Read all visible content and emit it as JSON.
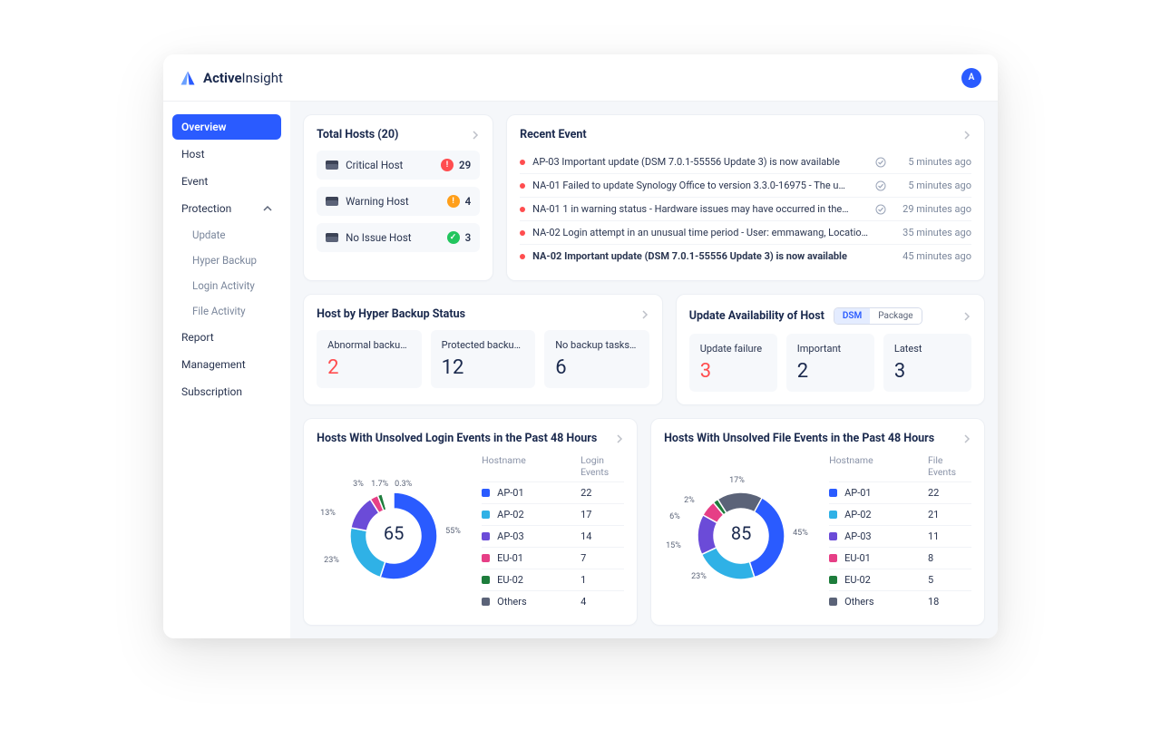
{
  "brand": {
    "strong": "Active",
    "light": "Insight"
  },
  "avatar": "A",
  "sidebar": {
    "items": [
      {
        "label": "Overview",
        "active": true
      },
      {
        "label": "Host"
      },
      {
        "label": "Event"
      },
      {
        "label": "Protection",
        "expandable": true,
        "expanded": true,
        "children": [
          {
            "label": "Update"
          },
          {
            "label": "Hyper Backup"
          },
          {
            "label": "Login Activity"
          },
          {
            "label": "File Activity"
          }
        ]
      },
      {
        "label": "Report"
      },
      {
        "label": "Management"
      },
      {
        "label": "Subscription"
      }
    ]
  },
  "totalHosts": {
    "title": "Total Hosts (20)",
    "rows": [
      {
        "label": "Critical Host",
        "dot": "red",
        "dotGlyph": "!",
        "count": "29"
      },
      {
        "label": "Warning Host",
        "dot": "orange",
        "dotGlyph": "!",
        "count": "4"
      },
      {
        "label": "No Issue Host",
        "dot": "green",
        "dotGlyph": "✓",
        "count": "3"
      }
    ]
  },
  "recent": {
    "title": "Recent Event",
    "events": [
      {
        "text": "AP-03 Important update (DSM 7.0.1-55556 Update 3) is now available",
        "check": true,
        "time": "5 minutes ago",
        "bold": false
      },
      {
        "text": "NA-01 Failed to update Synology Office to version 3.3.0-16975 - The u…",
        "check": true,
        "time": "5 minutes ago",
        "bold": false
      },
      {
        "text": "NA-01 1 in warning status - Hardware issues may have occurred in the…",
        "check": true,
        "time": "29 minutes ago",
        "bold": false
      },
      {
        "text": "NA-02 Login attempt in an unusual time period - User: emmawang, Locatio…",
        "check": false,
        "time": "35 minutes ago",
        "bold": false
      },
      {
        "text": "NA-02 Important update (DSM 7.0.1-55556 Update 3) is now available",
        "check": false,
        "time": "45 minutes ago",
        "bold": true
      }
    ]
  },
  "hyperBackup": {
    "title": "Host by Hyper Backup Status",
    "stats": [
      {
        "label": "Abnormal backups",
        "value": "2",
        "red": true
      },
      {
        "label": "Protected backup…",
        "value": "12"
      },
      {
        "label": "No backup tasks…",
        "value": "6"
      }
    ]
  },
  "updateAvail": {
    "title": "Update Availability of Host",
    "seg": [
      {
        "label": "DSM",
        "active": true
      },
      {
        "label": "Package"
      }
    ],
    "stats": [
      {
        "label": "Update failure",
        "value": "3",
        "red": true
      },
      {
        "label": "Important",
        "value": "2"
      },
      {
        "label": "Latest",
        "value": "3"
      }
    ]
  },
  "loginChart": {
    "title": "Hosts With Unsolved Login Events in the Past 48 Hours",
    "center": "65",
    "headers": [
      "Hostname",
      "Login Events"
    ],
    "legend": [
      {
        "color": "#2a5bff",
        "name": "AP-01",
        "num": "22"
      },
      {
        "color": "#2fb1e6",
        "name": "AP-02",
        "num": "17"
      },
      {
        "color": "#6b4bd8",
        "name": "AP-03",
        "num": "14"
      },
      {
        "color": "#e63f86",
        "name": "EU-01",
        "num": "7"
      },
      {
        "color": "#1e7d3c",
        "name": "EU-02",
        "num": "1"
      },
      {
        "color": "#5b6378",
        "name": "Others",
        "num": "4"
      }
    ],
    "labels": [
      {
        "text": "55%",
        "top": 68,
        "left": 142
      },
      {
        "text": "23%",
        "top": 100,
        "left": 8
      },
      {
        "text": "13%",
        "top": 48,
        "left": 4
      },
      {
        "text": "3%",
        "top": 16,
        "left": 40
      },
      {
        "text": "1.7%",
        "top": 16,
        "left": 60
      },
      {
        "text": "0.3%",
        "top": 16,
        "left": 86
      }
    ]
  },
  "fileChart": {
    "title": "Hosts With Unsolved File Events in the Past 48 Hours",
    "center": "85",
    "headers": [
      "Hostname",
      "File Events"
    ],
    "legend": [
      {
        "color": "#2a5bff",
        "name": "AP-01",
        "num": "22"
      },
      {
        "color": "#2fb1e6",
        "name": "AP-02",
        "num": "21"
      },
      {
        "color": "#6b4bd8",
        "name": "AP-03",
        "num": "11"
      },
      {
        "color": "#e63f86",
        "name": "EU-01",
        "num": "8"
      },
      {
        "color": "#1e7d3c",
        "name": "EU-02",
        "num": "5"
      },
      {
        "color": "#5b6378",
        "name": "Others",
        "num": "18"
      }
    ],
    "labels": [
      {
        "text": "45%",
        "top": 70,
        "left": 142
      },
      {
        "text": "23%",
        "top": 118,
        "left": 30
      },
      {
        "text": "15%",
        "top": 84,
        "left": 2
      },
      {
        "text": "6%",
        "top": 52,
        "left": 6
      },
      {
        "text": "2%",
        "top": 34,
        "left": 22
      },
      {
        "text": "17%",
        "top": 12,
        "left": 72
      }
    ]
  },
  "chart_data": [
    {
      "type": "pie",
      "title": "Hosts With Unsolved Login Events in the Past 48 Hours",
      "total": 65,
      "series": [
        {
          "name": "AP-01",
          "value": 22,
          "pct": 55,
          "color": "#2a5bff"
        },
        {
          "name": "AP-02",
          "value": 17,
          "pct": 23,
          "color": "#2fb1e6"
        },
        {
          "name": "AP-03",
          "value": 14,
          "pct": 13,
          "color": "#6b4bd8"
        },
        {
          "name": "EU-01",
          "value": 7,
          "pct": 3,
          "color": "#e63f86"
        },
        {
          "name": "EU-02",
          "value": 1,
          "pct": 1.7,
          "color": "#1e7d3c"
        },
        {
          "name": "Others",
          "value": 4,
          "pct": 0.3,
          "color": "#5b6378"
        }
      ]
    },
    {
      "type": "pie",
      "title": "Hosts With Unsolved File Events in the Past 48 Hours",
      "total": 85,
      "series": [
        {
          "name": "AP-01",
          "value": 22,
          "pct": 45,
          "color": "#2a5bff"
        },
        {
          "name": "AP-02",
          "value": 21,
          "pct": 23,
          "color": "#2fb1e6"
        },
        {
          "name": "AP-03",
          "value": 11,
          "pct": 15,
          "color": "#6b4bd8"
        },
        {
          "name": "EU-01",
          "value": 8,
          "pct": 6,
          "color": "#e63f86"
        },
        {
          "name": "EU-02",
          "value": 5,
          "pct": 2,
          "color": "#1e7d3c"
        },
        {
          "name": "Others",
          "value": 18,
          "pct": 17,
          "color": "#5b6378"
        }
      ]
    }
  ]
}
